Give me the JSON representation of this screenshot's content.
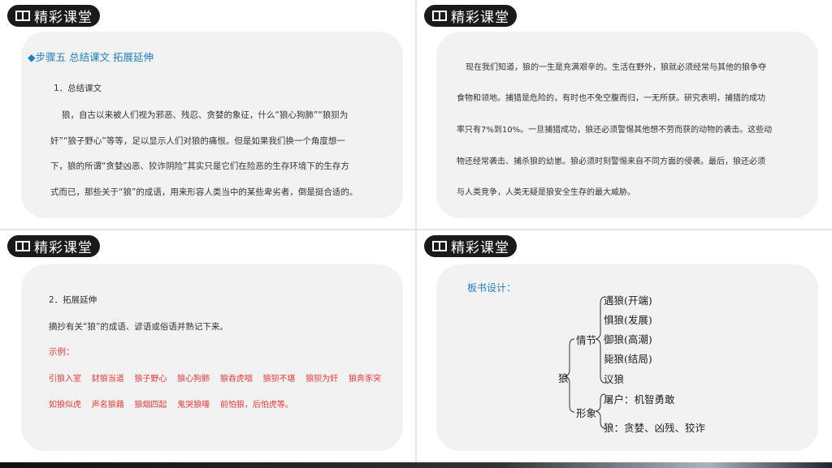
{
  "badge_title": "精彩课堂",
  "slide1": {
    "step": "◆步骤五  总结课文  拓展延伸",
    "heading": "1．总结课文",
    "lines": [
      "狼，自古以来被人们视为邪恶、残忍、贪婪的象征，什么“狼心狗肺”“狼狈为",
      "奸”“狼子野心”等等，足以显示人们对狼的痛恨。但是如果我们换一个角度想一",
      "下，狼的所谓“贪婪凶恶、狡诈阴险”其实只是它们在险恶的生存环境下的生存方",
      "式而已，那些关于“狼”的成语，用来形容人类当中的某些卑劣者，倒是挺合适的。"
    ]
  },
  "slide2": {
    "lines": [
      "现在我们知道，狼的一生是充满艰辛的。生活在野外，狼就必须经常与其他的狼争夺",
      "食物和领地。捕猎是危险的，有时也不免空腹而归，一无所获。研究表明，捕猎的成功",
      "率只有7%到10%。一旦捕猎成功，狼还必须警惕其他想不劳而获的动物的袭击。这些动",
      "物还经常袭击、捕杀狼的幼崽。狼必须时刻警惕来自不同方面的侵袭。最后，狼还必须",
      "与人类竞争，人类无疑是狼安全生存的最大威胁。"
    ]
  },
  "slide3": {
    "heading": "2．拓展延伸",
    "instruction": "摘抄有关“狼”的成语、谚语或俗语并熟记下来。",
    "example_label": "示例：",
    "examples_row1": [
      "引狼入室",
      "豺狼当道",
      "狼子野心",
      "狼心狗肺",
      "狼吞虎咽",
      "狼狈不堪",
      "狼狈为奸",
      "狼奔豕突"
    ],
    "examples_row2": [
      "如狼似虎",
      "声名狼藉",
      "狼烟四起",
      "鬼哭狼嚎",
      "前怕狼，后怕虎等。"
    ]
  },
  "slide4": {
    "label": "板书设计：",
    "root": "狼",
    "branch1": "情节",
    "branch1_items": [
      "遇狼(开端)",
      "惧狼(发展)",
      "御狼(高潮)",
      "毙狼(结局)",
      "议狼"
    ],
    "branch2": "形象",
    "branch2_items": [
      "屠户：机智勇敢",
      "狼：贪婪、凶残、狡诈"
    ]
  }
}
